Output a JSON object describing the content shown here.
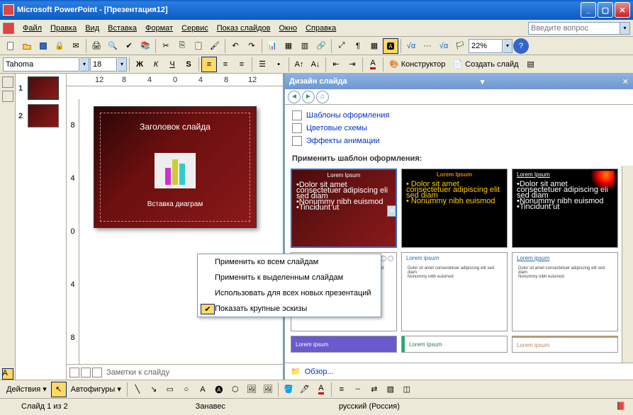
{
  "title": "Microsoft PowerPoint - [Презентация12]",
  "menu": {
    "file": "Файл",
    "edit": "Правка",
    "view": "Вид",
    "insert": "Вставка",
    "format": "Формат",
    "tools": "Сервис",
    "slideshow": "Показ слайдов",
    "window": "Окно",
    "help": "Справка"
  },
  "search_placeholder": "Введите вопрос",
  "formatting": {
    "font": "Tahoma",
    "size": "18",
    "zoom": "22%"
  },
  "toolbar2": {
    "designer": "Конструктор",
    "newslide": "Создать слайд"
  },
  "ruler": [
    "12",
    "8",
    "4",
    "0",
    "4",
    "8",
    "12"
  ],
  "vruler": [
    "8",
    "4",
    "0",
    "4",
    "8"
  ],
  "thumbs": [
    {
      "n": "1"
    },
    {
      "n": "2"
    }
  ],
  "slide": {
    "title": "Заголовок слайда",
    "chart": "Вставка диаграм"
  },
  "notes": "Заметки к слайду",
  "taskpane": {
    "title": "Дизайн слайда",
    "links": {
      "templates": "Шаблоны оформления",
      "schemes": "Цветовые схемы",
      "anim": "Эффекты анимации"
    },
    "apply": "Применить шаблон оформления:",
    "overview": "Обзор..."
  },
  "tpl": {
    "lorem": "Lorem Ipsum",
    "loremL": "Lorem ipsum",
    "bullets_red": "•Dolor sit amet consectetuer adipiscing eli sed diam\n  •Nonummy nibh euismod\n  •Tincidunt ut",
    "bullets_org": "• Dolor sit amet consectetuer adipiscing elit sed diam\n• Nonummy nibh euismod",
    "bullets_wh": "Dolor sit amet consectetuer adipiscing elit sed diam\n  Nonummy nibh euismod"
  },
  "ctx": {
    "all": "Применить ко всем слайдам",
    "sel": "Применить к выделенным слайдам",
    "new": "Использовать для всех новых презентаций",
    "large": "Показать крупные эскизы"
  },
  "drawbar": {
    "actions": "Действия",
    "autoshapes": "Автофигуры"
  },
  "status": {
    "slide": "Слайд 1 из 2",
    "theme": "Занавес",
    "lang": "русский (Россия)"
  }
}
